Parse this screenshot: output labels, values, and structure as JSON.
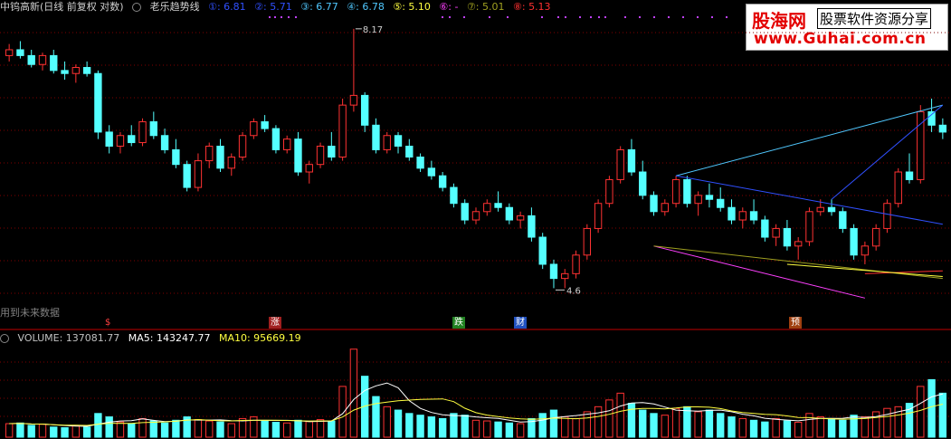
{
  "header": {
    "title": "中钨高新(日线 前复权 对数)",
    "indicator_name": "老乐趋势线",
    "indicators": [
      {
        "label": "①: 6.81",
        "color": "#3050ff"
      },
      {
        "label": "②: 5.71",
        "color": "#3050ff"
      },
      {
        "label": "③: 6.77",
        "color": "#50c8ff"
      },
      {
        "label": "④: 6.78",
        "color": "#50c8ff"
      },
      {
        "label": "⑤: 5.10",
        "color": "#ffff40"
      },
      {
        "label": "⑥: -",
        "color": "#ff40ff"
      },
      {
        "label": "⑦: 5.01",
        "color": "#a0a020"
      },
      {
        "label": "⑧: 5.13",
        "color": "#ff3030"
      }
    ]
  },
  "logo": {
    "cn": "股海网",
    "tag": "股票软件资源分享",
    "url": "www.Guhai.com.cn"
  },
  "side_note": "用到未来数据",
  "markers": [
    {
      "text": "$",
      "color": "#ff4040",
      "bg": "#600000"
    },
    {
      "text": "涨",
      "color": "#ffffff",
      "bg": "#a02020"
    },
    {
      "text": "跌",
      "color": "#ffffff",
      "bg": "#208020"
    },
    {
      "text": "财",
      "color": "#ffffff",
      "bg": "#2050c0"
    },
    {
      "text": "预",
      "color": "#ffffff",
      "bg": "#a04010"
    }
  ],
  "volume_header": {
    "volume": "VOLUME: 137081.77",
    "ma5": "MA5: 143247.77",
    "ma10": "MA10: 95669.19",
    "colors": {
      "volume": "#c0c0c0",
      "ma5": "#ffffff",
      "ma10": "#ffff40"
    }
  },
  "colors": {
    "up": "#ff3232",
    "down": "#54ffff",
    "grid": "#800000"
  },
  "chart_data": {
    "type": "candlestick",
    "title": "中钨高新(日线 前复权 对数)",
    "annotations": {
      "high_label": "8.17",
      "low_label": "4.6"
    },
    "candles": [
      [
        7.7,
        7.9,
        7.6,
        7.8
      ],
      [
        7.8,
        7.95,
        7.65,
        7.7
      ],
      [
        7.7,
        7.8,
        7.5,
        7.55
      ],
      [
        7.55,
        7.75,
        7.45,
        7.7
      ],
      [
        7.7,
        7.8,
        7.4,
        7.45
      ],
      [
        7.45,
        7.6,
        7.3,
        7.4
      ],
      [
        7.4,
        7.55,
        7.25,
        7.5
      ],
      [
        7.5,
        7.6,
        7.35,
        7.4
      ],
      [
        7.4,
        7.45,
        6.4,
        6.5
      ],
      [
        6.5,
        6.6,
        6.2,
        6.3
      ],
      [
        6.3,
        6.5,
        6.2,
        6.45
      ],
      [
        6.45,
        6.6,
        6.3,
        6.35
      ],
      [
        6.35,
        6.7,
        6.3,
        6.65
      ],
      [
        6.65,
        6.8,
        6.4,
        6.45
      ],
      [
        6.45,
        6.55,
        6.2,
        6.25
      ],
      [
        6.25,
        6.4,
        6.0,
        6.05
      ],
      [
        6.05,
        6.1,
        5.7,
        5.75
      ],
      [
        5.75,
        6.2,
        5.7,
        6.1
      ],
      [
        6.1,
        6.35,
        6.0,
        6.3
      ],
      [
        6.3,
        6.4,
        5.95,
        6.0
      ],
      [
        6.0,
        6.2,
        5.9,
        6.15
      ],
      [
        6.15,
        6.5,
        6.1,
        6.45
      ],
      [
        6.45,
        6.7,
        6.4,
        6.65
      ],
      [
        6.65,
        6.75,
        6.5,
        6.55
      ],
      [
        6.55,
        6.6,
        6.2,
        6.25
      ],
      [
        6.25,
        6.45,
        6.2,
        6.4
      ],
      [
        6.4,
        6.5,
        5.9,
        5.95
      ],
      [
        5.95,
        6.1,
        5.8,
        6.05
      ],
      [
        6.05,
        6.35,
        6.0,
        6.3
      ],
      [
        6.3,
        6.5,
        6.1,
        6.15
      ],
      [
        6.15,
        7.0,
        6.1,
        6.9
      ],
      [
        6.9,
        8.17,
        6.8,
        7.05
      ],
      [
        7.05,
        7.1,
        6.5,
        6.6
      ],
      [
        6.6,
        6.7,
        6.2,
        6.25
      ],
      [
        6.25,
        6.5,
        6.2,
        6.45
      ],
      [
        6.45,
        6.5,
        6.2,
        6.3
      ],
      [
        6.3,
        6.4,
        6.1,
        6.15
      ],
      [
        6.15,
        6.2,
        5.95,
        6.0
      ],
      [
        6.0,
        6.1,
        5.85,
        5.9
      ],
      [
        5.9,
        5.95,
        5.7,
        5.75
      ],
      [
        5.75,
        5.8,
        5.5,
        5.55
      ],
      [
        5.55,
        5.6,
        5.3,
        5.35
      ],
      [
        5.35,
        5.5,
        5.3,
        5.45
      ],
      [
        5.45,
        5.6,
        5.4,
        5.55
      ],
      [
        5.55,
        5.7,
        5.45,
        5.5
      ],
      [
        5.5,
        5.55,
        5.3,
        5.35
      ],
      [
        5.35,
        5.45,
        5.25,
        5.4
      ],
      [
        5.4,
        5.5,
        5.1,
        5.15
      ],
      [
        5.15,
        5.2,
        4.8,
        4.85
      ],
      [
        4.85,
        4.9,
        4.6,
        4.7
      ],
      [
        4.7,
        4.8,
        4.6,
        4.75
      ],
      [
        4.75,
        5.0,
        4.7,
        4.95
      ],
      [
        4.95,
        5.3,
        4.9,
        5.25
      ],
      [
        5.25,
        5.6,
        5.2,
        5.55
      ],
      [
        5.55,
        5.9,
        5.5,
        5.85
      ],
      [
        5.85,
        6.3,
        5.8,
        6.25
      ],
      [
        6.25,
        6.4,
        5.9,
        5.95
      ],
      [
        5.95,
        6.1,
        5.6,
        5.65
      ],
      [
        5.65,
        5.7,
        5.4,
        5.45
      ],
      [
        5.45,
        5.6,
        5.4,
        5.55
      ],
      [
        5.55,
        5.9,
        5.5,
        5.85
      ],
      [
        5.85,
        5.9,
        5.5,
        5.55
      ],
      [
        5.55,
        5.7,
        5.4,
        5.65
      ],
      [
        5.65,
        5.8,
        5.5,
        5.6
      ],
      [
        5.6,
        5.75,
        5.45,
        5.5
      ],
      [
        5.5,
        5.6,
        5.3,
        5.35
      ],
      [
        5.35,
        5.5,
        5.25,
        5.45
      ],
      [
        5.45,
        5.6,
        5.3,
        5.35
      ],
      [
        5.35,
        5.4,
        5.1,
        5.15
      ],
      [
        5.15,
        5.3,
        5.05,
        5.25
      ],
      [
        5.25,
        5.35,
        5.0,
        5.05
      ],
      [
        5.05,
        5.15,
        4.9,
        5.1
      ],
      [
        5.1,
        5.5,
        5.05,
        5.45
      ],
      [
        5.45,
        5.6,
        5.4,
        5.5
      ],
      [
        5.5,
        5.6,
        5.4,
        5.45
      ],
      [
        5.45,
        5.5,
        5.2,
        5.25
      ],
      [
        5.25,
        5.3,
        4.9,
        4.95
      ],
      [
        4.95,
        5.1,
        4.85,
        5.05
      ],
      [
        5.05,
        5.3,
        5.0,
        5.25
      ],
      [
        5.25,
        5.6,
        5.2,
        5.55
      ],
      [
        5.55,
        6.0,
        5.5,
        5.95
      ],
      [
        5.95,
        6.2,
        5.8,
        5.85
      ],
      [
        5.85,
        6.9,
        5.8,
        6.8
      ],
      [
        6.8,
        7.0,
        6.5,
        6.6
      ],
      [
        6.6,
        6.7,
        6.4,
        6.5
      ]
    ],
    "volume": {
      "values": [
        40,
        42,
        35,
        38,
        30,
        28,
        34,
        30,
        70,
        60,
        45,
        40,
        55,
        48,
        42,
        50,
        60,
        52,
        48,
        45,
        40,
        55,
        60,
        48,
        44,
        42,
        50,
        46,
        52,
        48,
        150,
        260,
        180,
        120,
        90,
        80,
        70,
        65,
        60,
        55,
        70,
        65,
        50,
        48,
        45,
        42,
        40,
        55,
        70,
        80,
        60,
        55,
        75,
        90,
        110,
        130,
        100,
        80,
        70,
        65,
        85,
        90,
        75,
        80,
        70,
        60,
        55,
        50,
        45,
        55,
        48,
        44,
        70,
        60,
        55,
        50,
        65,
        60,
        75,
        85,
        90,
        100,
        150,
        170,
        130
      ],
      "ma5": "white line",
      "ma10": "yellow line"
    }
  }
}
